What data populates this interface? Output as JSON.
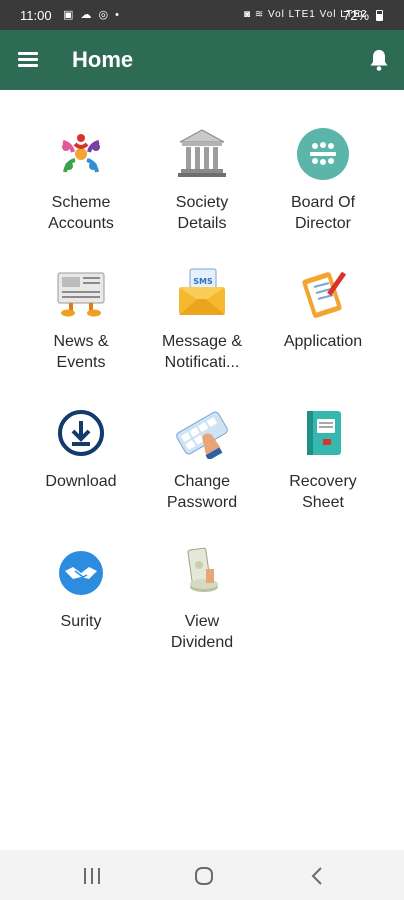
{
  "status_bar": {
    "time": "11:00",
    "left_icons": "▣ ☁ ◎ •",
    "right_icons": "◙ ≋ Vol LTE1 Vol LTE2",
    "battery": "72%"
  },
  "app_bar": {
    "title": "Home",
    "menu_icon": "hamburger-menu-icon",
    "notification_icon": "bell-icon"
  },
  "menu": [
    {
      "line1": "Scheme",
      "line2": "Accounts",
      "icon": "scheme-accounts-icon"
    },
    {
      "line1": "Society",
      "line2": "Details",
      "icon": "bank-building-icon"
    },
    {
      "line1": "Board Of",
      "line2": "Director",
      "icon": "board-meeting-icon"
    },
    {
      "line1": "News &",
      "line2": "Events",
      "icon": "newspaper-icon"
    },
    {
      "line1": "Message &",
      "line2": "Notificati...",
      "icon": "sms-envelope-icon"
    },
    {
      "line1": "Application",
      "line2": "",
      "icon": "clipboard-icon"
    },
    {
      "line1": "Download",
      "line2": "",
      "icon": "download-icon"
    },
    {
      "line1": "Change",
      "line2": "Password",
      "icon": "keyboard-password-icon"
    },
    {
      "line1": "Recovery",
      "line2": "Sheet",
      "icon": "recovery-book-icon"
    },
    {
      "line1": "Surity",
      "line2": "",
      "icon": "handshake-icon"
    },
    {
      "line1": "View",
      "line2": "Dividend",
      "icon": "money-stack-icon"
    }
  ],
  "nav_bar": {
    "recents_icon": "recents-icon",
    "home_icon": "home-circle-icon",
    "back_icon": "back-chevron-icon"
  },
  "colors": {
    "app_bar": "#2e6b55",
    "status_bar": "#3a3a3a",
    "nav_bar": "#f3f3f3",
    "icon_teal": "#5bb5a8",
    "icon_navy": "#123a6b",
    "icon_blue": "#2b8ce0"
  }
}
